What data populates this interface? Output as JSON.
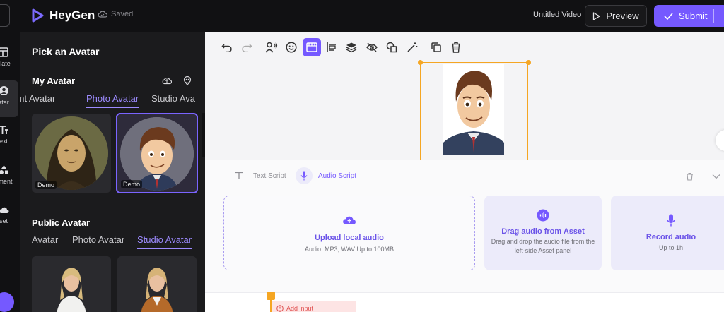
{
  "header": {
    "logo_text": "HeyGen",
    "saved_label": "Saved",
    "video_title": "Untitled Video",
    "preview_label": "Preview",
    "submit_label": "Submit"
  },
  "rail": {
    "items": [
      {
        "label": "plate",
        "icon": "template-icon"
      },
      {
        "label": "atar",
        "icon": "avatar-icon"
      },
      {
        "label": "ext",
        "icon": "text-icon"
      },
      {
        "label": "ement",
        "icon": "element-icon"
      },
      {
        "label": "set",
        "icon": "asset-icon"
      }
    ]
  },
  "panel": {
    "title": "Pick an Avatar",
    "my_avatar": {
      "title": "My Avatar",
      "tabs": [
        "ant Avatar",
        "Photo Avatar",
        "Studio Ava"
      ],
      "active_tab": "Photo Avatar",
      "cards": [
        {
          "badge": "Demo",
          "subject": "Mona Lisa portrait"
        },
        {
          "badge": "Demo",
          "subject": "Cartoon man"
        }
      ]
    },
    "public_avatar": {
      "title": "Public Avatar",
      "tabs": [
        "Avatar",
        "Photo Avatar",
        "Studio Avatar"
      ],
      "active_tab": "Studio Avatar"
    }
  },
  "script": {
    "tabs": [
      {
        "label": "Text Script",
        "active": false
      },
      {
        "label": "Audio Script",
        "active": true
      }
    ],
    "options": [
      {
        "title": "Upload local audio",
        "subtitle": "Audio: MP3, WAV Up to 100MB"
      },
      {
        "title": "Drag audio from Asset",
        "subtitle": "Drag and drop the audio file from the left-side Asset panel"
      },
      {
        "title": "Record audio",
        "subtitle": "Up to 1h"
      }
    ]
  },
  "timeline": {
    "add_input_label": "Add input"
  },
  "colors": {
    "accent": "#7559ff",
    "selection": "#f5a623"
  }
}
